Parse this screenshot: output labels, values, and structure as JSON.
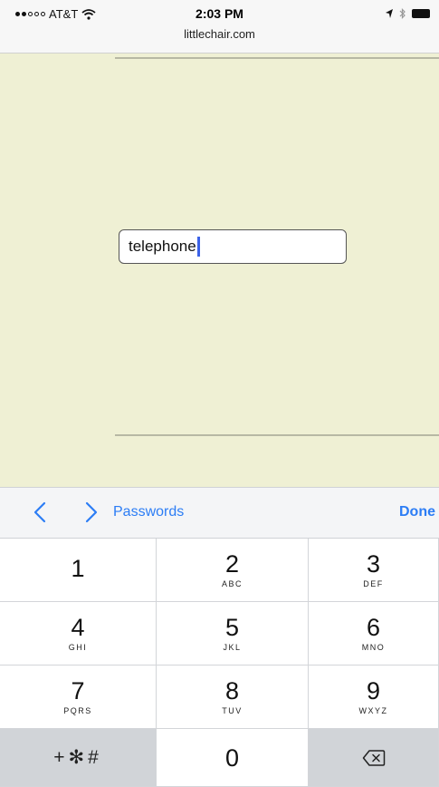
{
  "status_bar": {
    "carrier": "AT&T",
    "time": "2:03 PM",
    "url": "littlechair.com"
  },
  "page": {
    "input_value": "telephone",
    "background_color": "#eff0d4"
  },
  "accessory_bar": {
    "passwords_label": "Passwords",
    "done_label": "Done",
    "accent_color": "#2c7df5"
  },
  "keypad": {
    "keys": [
      {
        "digit": "1",
        "letters": ""
      },
      {
        "digit": "2",
        "letters": "ABC"
      },
      {
        "digit": "3",
        "letters": "DEF"
      },
      {
        "digit": "4",
        "letters": "GHI"
      },
      {
        "digit": "5",
        "letters": "JKL"
      },
      {
        "digit": "6",
        "letters": "MNO"
      },
      {
        "digit": "7",
        "letters": "PQRS"
      },
      {
        "digit": "8",
        "letters": "TUV"
      },
      {
        "digit": "9",
        "letters": "WXYZ"
      }
    ],
    "symbols_label": "+✻#",
    "zero": "0"
  }
}
